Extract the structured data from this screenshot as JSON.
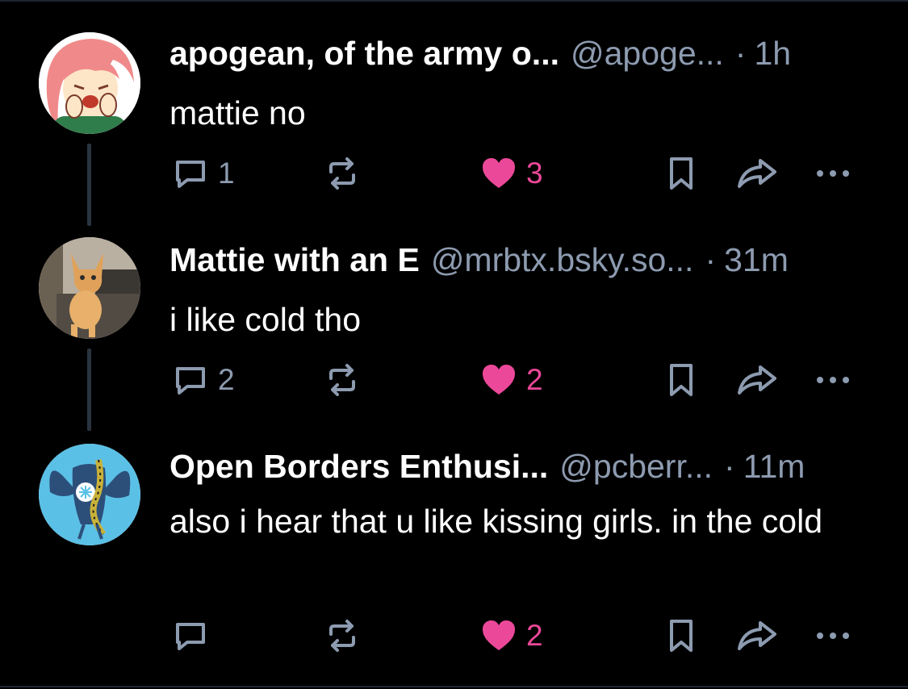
{
  "colors": {
    "background": "#000000",
    "muted": "#8d9bb0",
    "like": "#ec4899",
    "thread_line": "#2a3441"
  },
  "posts": [
    {
      "display_name": "apogean, of the army o...",
      "handle": "@apoge...",
      "separator": "·",
      "time": "1h",
      "text": "mattie no",
      "reply_count": "1",
      "like_count": "3",
      "avatar": "anime-girl-avatar"
    },
    {
      "display_name": "Mattie with an E",
      "handle": "@mrbtx.bsky.so...",
      "separator": "·",
      "time": "31m",
      "text": "i like cold tho",
      "reply_count": "2",
      "like_count": "2",
      "avatar": "orange-cat-avatar"
    },
    {
      "display_name": "Open Borders Enthusi...",
      "handle": "@pcberr...",
      "separator": "·",
      "time": "11m",
      "text": "also i hear that u like kissing girls. in the cold",
      "reply_count": "",
      "like_count": "2",
      "avatar": "bird-snake-avatar"
    }
  ],
  "icons": [
    "reply-icon",
    "repost-icon",
    "heart-icon",
    "bookmark-icon",
    "share-icon",
    "more-icon"
  ]
}
